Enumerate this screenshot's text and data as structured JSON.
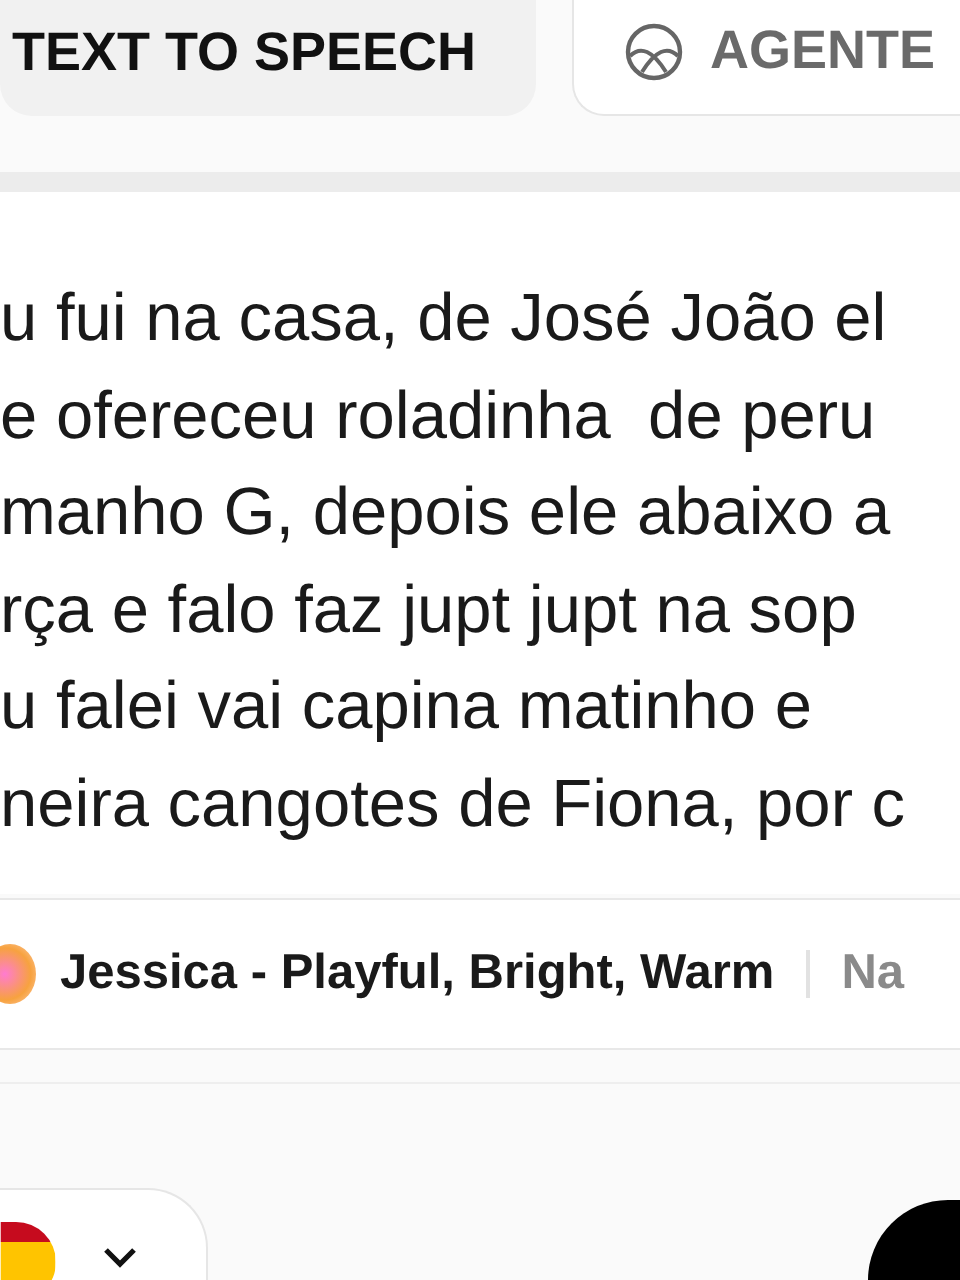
{
  "tabs": [
    {
      "label": "TEXT TO SPEECH",
      "selected": true,
      "kind": "plain"
    },
    {
      "label": "AGENTE",
      "selected": false,
      "kind": "agent"
    }
  ],
  "editor": {
    "lines": [
      "u fui na casa, de José João el",
      "e ofereceu roladinha  de peru",
      "manho G, depois ele abaixo a",
      "rça e falo faz jupt jupt na sop",
      "u falei vai capina matinho e",
      "neira cangotes de Fiona, por c"
    ]
  },
  "voice": {
    "name": "Jessica - Playful, Bright, Warm",
    "next": "Na"
  }
}
